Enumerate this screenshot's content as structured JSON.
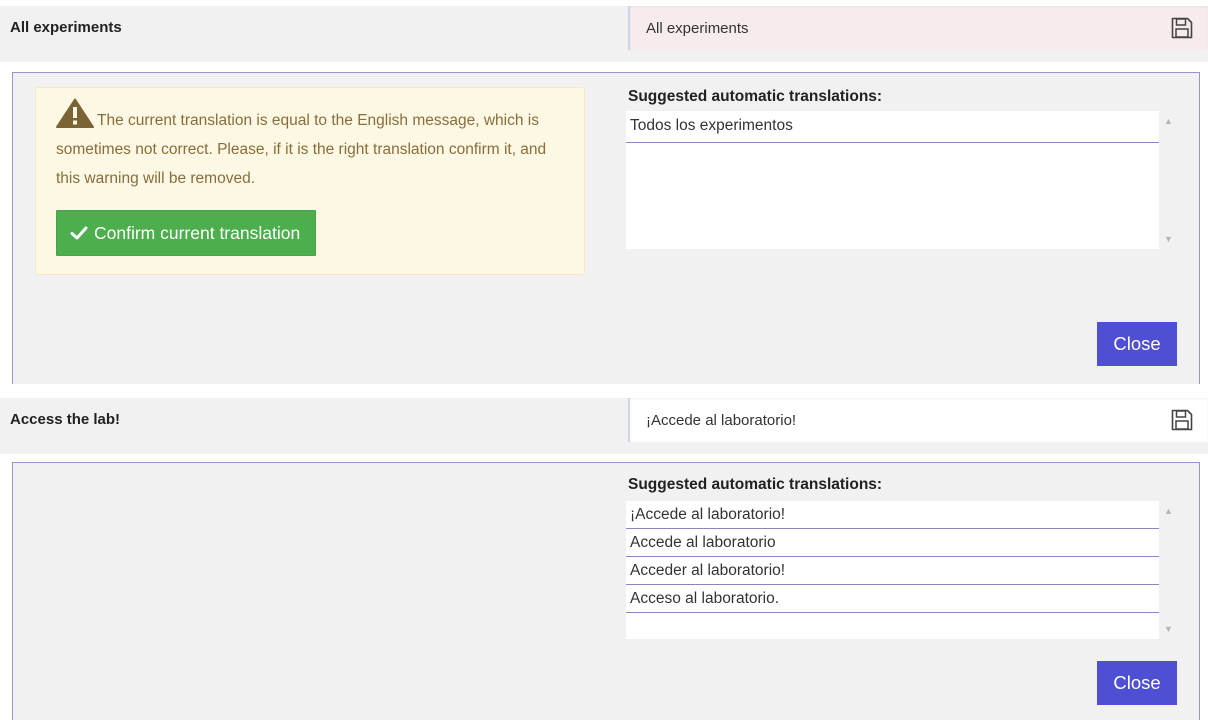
{
  "entries": [
    {
      "label": "All experiments",
      "translation": "All experiments",
      "warning_text": "The current translation is equal to the English message, which is sometimes not correct. Please, if it is the right translation confirm it, and this warning will be removed.",
      "confirm_label": "Confirm current translation",
      "suggestions_title": "Suggested automatic translations:",
      "suggestions": [
        "Todos los experimentos"
      ],
      "close_label": "Close"
    },
    {
      "label": "Access the lab!",
      "translation": "¡Accede al laboratorio!",
      "suggestions_title": "Suggested automatic translations:",
      "suggestions": [
        "¡Accede al laboratorio!",
        "Accede al laboratorio",
        "Acceder al laboratorio!",
        "Acceso al laboratorio."
      ],
      "close_label": "Close"
    }
  ],
  "colors": {
    "panel_border": "#9a94cc",
    "close_button": "#4f4fd4",
    "confirm_button": "#4cae4c",
    "warning_bg": "#fcf8e3",
    "warning_text": "#8a6d3b"
  },
  "icons": {
    "save": "floppy-disk-icon",
    "warning": "warning-triangle-icon",
    "confirm": "checkmark-icon"
  }
}
